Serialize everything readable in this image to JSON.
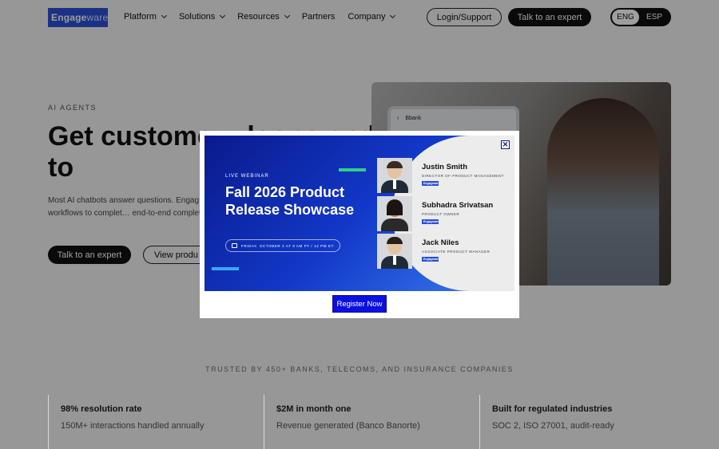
{
  "brand": {
    "logo_main": "Engage",
    "logo_accent": "ware",
    "color": "#2a4fd6"
  },
  "nav": {
    "items": [
      {
        "label": "Platform",
        "dropdown": true
      },
      {
        "label": "Solutions",
        "dropdown": true
      },
      {
        "label": "Resources",
        "dropdown": true
      },
      {
        "label": "Partners",
        "dropdown": false
      },
      {
        "label": "Company",
        "dropdown": true
      }
    ],
    "login_label": "Login/Support",
    "expert_label": "Talk to an expert",
    "lang_active": "ENG",
    "lang_inactive": "ESP"
  },
  "hero": {
    "eyebrow": "AI AGENTS",
    "title": "Get custome… loops and to",
    "desc": "Most AI chatbots answer questions. Engag… AI with policy-aware workflows to complet… end-to-end completely. No \"please call us.\"",
    "primary_btn": "Talk to an expert",
    "secondary_btn": "View produ",
    "phone_bank": "Bbank"
  },
  "modal": {
    "live_label": "LIVE WEBINAR",
    "title": "Fall 2026 Product Release Showcase",
    "date": "FRIDAY, OCTOBER 2 AT 9 AM PT / 12 PM ET",
    "close_symbol": "✕",
    "register_label": "Register Now",
    "speaker_chip": "Engageware",
    "speakers": [
      {
        "name": "Justin Smith",
        "role": "DIRECTOR OF PRODUCT MANAGEMENT"
      },
      {
        "name": "Subhadra Srivatsan",
        "role": "PRODUCT OWNER"
      },
      {
        "name": "Jack Niles",
        "role": "ASSOCIATE PRODUCT MANAGER"
      }
    ]
  },
  "trusted": "TRUSTED BY 450+ BANKS, TELECOMS, AND INSURANCE COMPANIES",
  "stats": [
    {
      "heading": "98% resolution rate",
      "sub": "150M+ interactions handled annually"
    },
    {
      "heading": "$2M in month one",
      "sub": "Revenue generated (Banco Banorte)"
    },
    {
      "heading": "Built for regulated industries",
      "sub": "SOC 2, ISO 27001, audit-ready"
    }
  ]
}
